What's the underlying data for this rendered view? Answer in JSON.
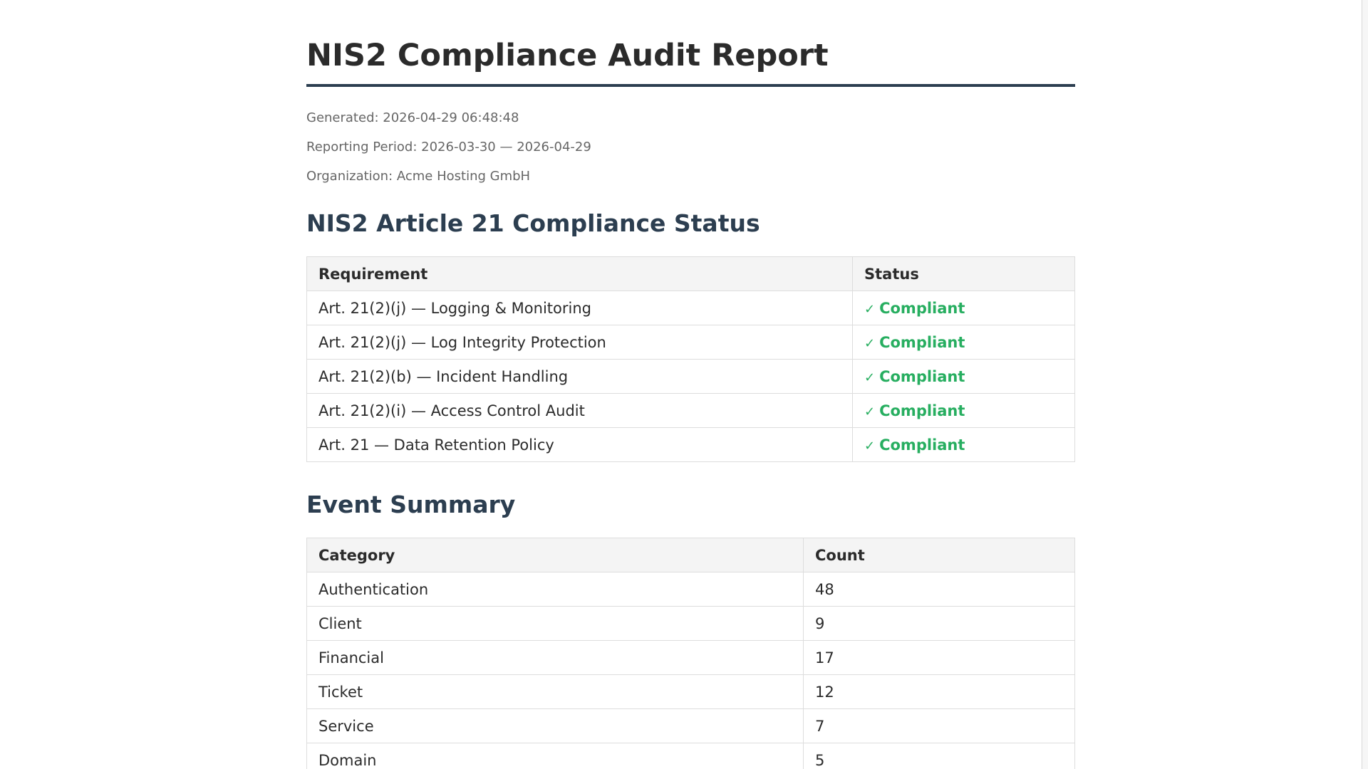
{
  "report": {
    "title": "NIS2 Compliance Audit Report",
    "generated": "Generated: 2026-04-29 06:48:48",
    "reporting_period": "Reporting Period: 2026-03-30 — 2026-04-29",
    "organization": "Organization: Acme Hosting GmbH"
  },
  "compliance": {
    "heading": "NIS2 Article 21 Compliance Status",
    "columns": [
      "Requirement",
      "Status"
    ],
    "rows": [
      {
        "requirement": "Art. 21(2)(j) — Logging & Monitoring",
        "status": "Compliant"
      },
      {
        "requirement": "Art. 21(2)(j) — Log Integrity Protection",
        "status": "Compliant"
      },
      {
        "requirement": "Art. 21(2)(b) — Incident Handling",
        "status": "Compliant"
      },
      {
        "requirement": "Art. 21(2)(i) — Access Control Audit",
        "status": "Compliant"
      },
      {
        "requirement": "Art. 21 — Data Retention Policy",
        "status": "Compliant"
      }
    ],
    "status_icon": "check-icon",
    "status_symbol": "✓",
    "status_color": "#27ae60"
  },
  "event_summary": {
    "heading": "Event Summary",
    "columns": [
      "Category",
      "Count"
    ],
    "rows": [
      {
        "category": "Authentication",
        "count": "48"
      },
      {
        "category": "Client",
        "count": "9"
      },
      {
        "category": "Financial",
        "count": "17"
      },
      {
        "category": "Ticket",
        "count": "12"
      },
      {
        "category": "Service",
        "count": "7"
      },
      {
        "category": "Domain",
        "count": "5"
      }
    ]
  },
  "colors": {
    "heading": "#2c3e50",
    "title_rule": "#2c3e50",
    "meta_text": "#666666",
    "table_header_bg": "#f4f4f4"
  }
}
